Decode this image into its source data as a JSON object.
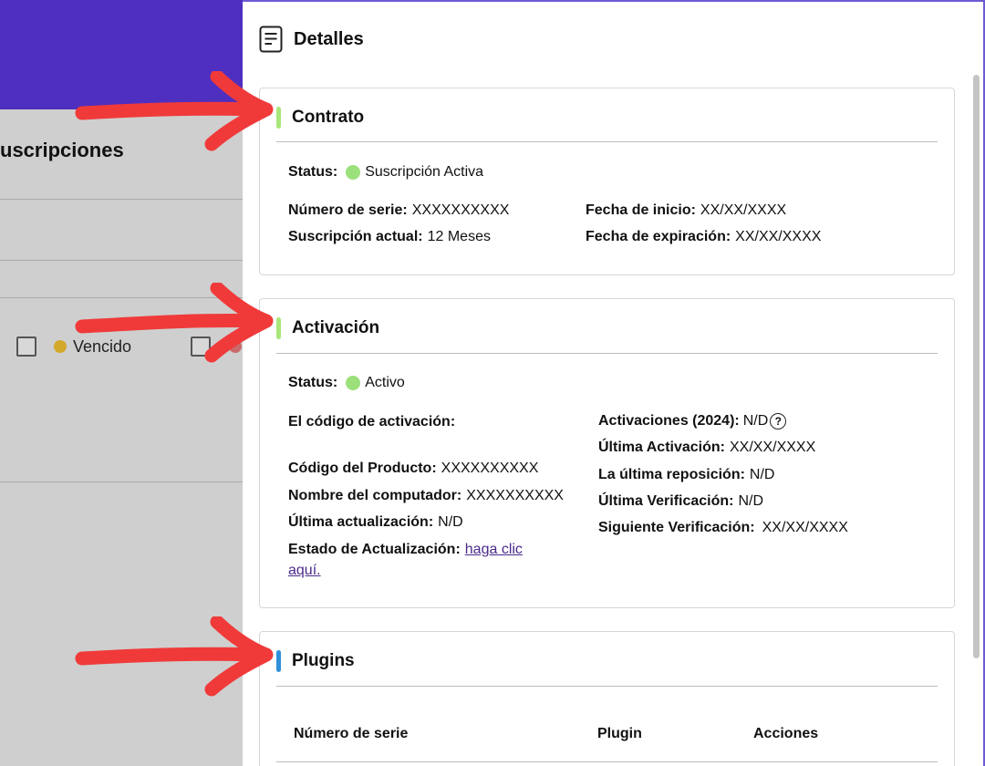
{
  "background": {
    "header_color": "#4f2fbf",
    "title": "uscripciones",
    "status_label": "Vencido",
    "status_dot_color": "#d4a82a",
    "second_dot_color": "#c96a6a"
  },
  "drawer": {
    "title": "Detalles",
    "icon": "document-icon",
    "contrato": {
      "title": "Contrato",
      "accent_color": "#a8e67a",
      "status_label": "Status:",
      "status_value": "Suscripción Activa",
      "status_color": "#9be07a",
      "serial_label": "Número de serie:",
      "serial_value": "XXXXXXXXXX",
      "subscription_label": "Suscripción actual:",
      "subscription_value": "12 Meses",
      "start_label": "Fecha de inicio:",
      "start_value": "XX/XX/XXXX",
      "expiry_label": "Fecha de expiración:",
      "expiry_value": "XX/XX/XXXX"
    },
    "activacion": {
      "title": "Activación",
      "accent_color": "#a8e67a",
      "status_label": "Status:",
      "status_value": "Activo",
      "status_color": "#9be07a",
      "code_label": "El código de activación:",
      "product_code_label": "Código del Producto:",
      "product_code_value": "XXXXXXXXXX",
      "computer_label": "Nombre del computador:",
      "computer_value": "XXXXXXXXXX",
      "last_update_label": "Última actualización:",
      "last_update_value": "N/D",
      "update_state_label": "Estado de Actualización:",
      "update_link_line1": "haga clic",
      "update_link_line2": "aquí.",
      "activations_label": "Activaciones (2024):",
      "activations_value": "N/D",
      "help_glyph": "?",
      "last_activation_label": "Última Activación:",
      "last_activation_value": "XX/XX/XXXX",
      "last_reset_label": "La última reposición:",
      "last_reset_value": "N/D",
      "last_verification_label": "Última Verificación:",
      "last_verification_value": "N/D",
      "next_verification_label": "Siguiente Verificación:",
      "next_verification_value": "XX/XX/XXXX"
    },
    "plugins": {
      "title": "Plugins",
      "accent_color": "#2f8fd8",
      "columns": [
        "Número de serie",
        "Plugin",
        "Acciones"
      ]
    }
  },
  "annotation": {
    "arrow_color": "#f03a3a"
  }
}
